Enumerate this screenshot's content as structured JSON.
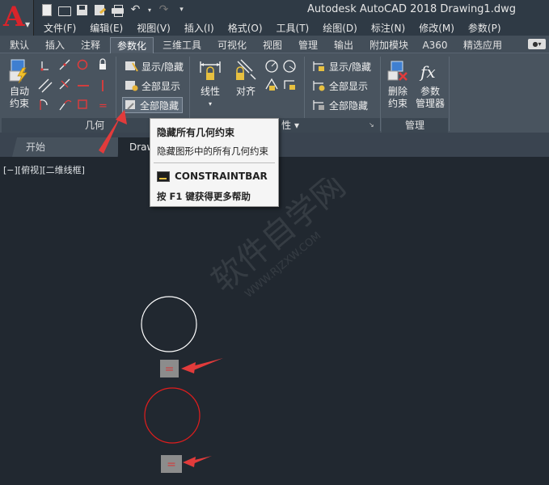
{
  "title_bar": {
    "window_title": "Autodesk AutoCAD 2018    Drawing1.dwg",
    "app_letter": "A",
    "quick_access_icons": [
      "new-icon",
      "open-icon",
      "save-icon",
      "saveas-icon",
      "print-icon",
      "undo-icon",
      "redo-icon",
      "qat-dropdown-icon"
    ]
  },
  "menu": [
    "文件(F)",
    "编辑(E)",
    "视图(V)",
    "插入(I)",
    "格式(O)",
    "工具(T)",
    "绘图(D)",
    "标注(N)",
    "修改(M)",
    "参数(P)"
  ],
  "ribbon_tabs": [
    "默认",
    "插入",
    "注释",
    "参数化",
    "三维工具",
    "可视化",
    "视图",
    "管理",
    "输出",
    "附加模块",
    "A360",
    "精选应用"
  ],
  "active_ribbon_tab": "参数化",
  "ribbon": {
    "geometry_panel": {
      "auto_constrain_label": "自动\n约束",
      "auto_constrain_l1": "自动",
      "auto_constrain_l2": "约束",
      "show_hide_label": "显示/隐藏",
      "show_all_label": "全部显示",
      "hide_all_label": "全部隐藏",
      "panel_title": "几何"
    },
    "dimensional_panel": {
      "linear_label": "线性",
      "aligned_label": "对齐",
      "show_hide_label": "显示/隐藏",
      "show_all_label": "全部显示",
      "hide_all_label": "全部隐藏",
      "panel_title_suffix": "性 ▾"
    },
    "manage_panel": {
      "delete_constraint_l1": "删除",
      "delete_constraint_l2": "约束",
      "parameters_manager_l1": "参数",
      "parameters_manager_l2": "管理器",
      "panel_title": "管理"
    }
  },
  "doc_tabs": {
    "start": "开始",
    "drawing": "Draw"
  },
  "viewport": {
    "label": "[−][俯视][二维线框]",
    "constraint_glyph": "="
  },
  "tooltip": {
    "title": "隐藏所有几何约束",
    "description": "隐藏图形中的所有几何约束",
    "command": "CONSTRAINTBAR",
    "help_prefix": "按 ",
    "help_key": "F1",
    "help_suffix": " 键获得更多帮助"
  },
  "colors": {
    "app_red": "#d9242b",
    "annotation_arrow": "#e23b3b",
    "circle_white": "#ffffff",
    "circle_red": "#e01d1d",
    "constraint_icon_bg": "#8c8c8c",
    "constraint_glyph": "#d13a3a"
  }
}
